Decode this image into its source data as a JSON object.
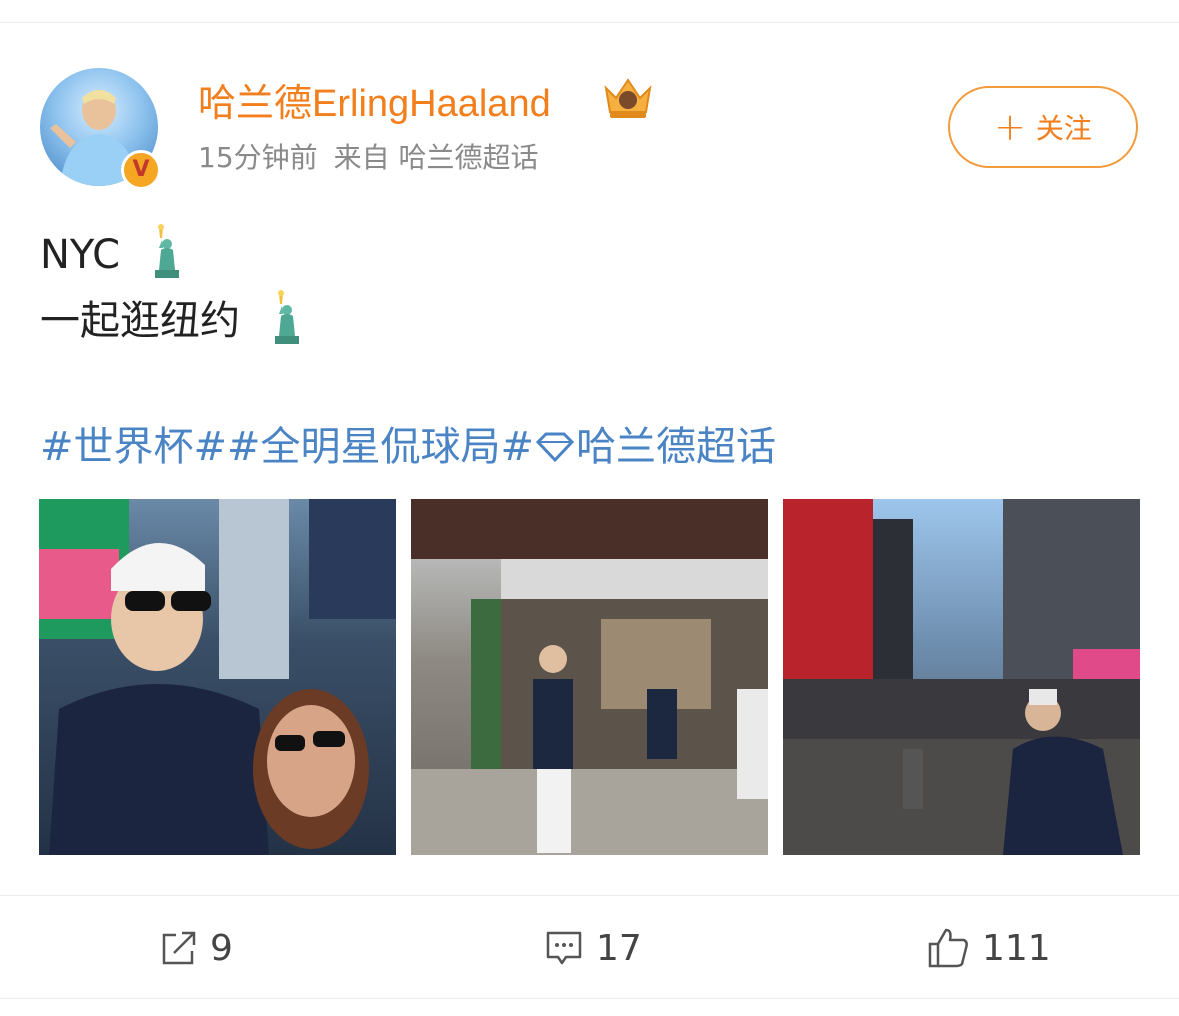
{
  "post": {
    "username": "哈兰德ErlingHaaland",
    "time": "15分钟前",
    "source": "来自 哈兰德超话",
    "follow_label": "关注",
    "follow_plus": "+",
    "verified_badge": "V",
    "text_line1": "NYC",
    "text_line2": "一起逛纽约",
    "tags": {
      "tag1": "#世界杯#",
      "tag2": "#全明星侃球局#",
      "tag3": "哈兰德超话"
    },
    "emoji": "statue-of-liberty-icon",
    "photos": [
      {
        "name": "photo-selfie-times-square"
      },
      {
        "name": "photo-katz-deli"
      },
      {
        "name": "photo-times-square-street"
      }
    ]
  },
  "actions": {
    "repost_count": "9",
    "comment_count": "17",
    "like_count": "111"
  },
  "colors": {
    "username": "#f27e1c",
    "hashtag": "#4a84c4",
    "meta": "#8a8a8a",
    "follow_border": "#f29b3c"
  }
}
